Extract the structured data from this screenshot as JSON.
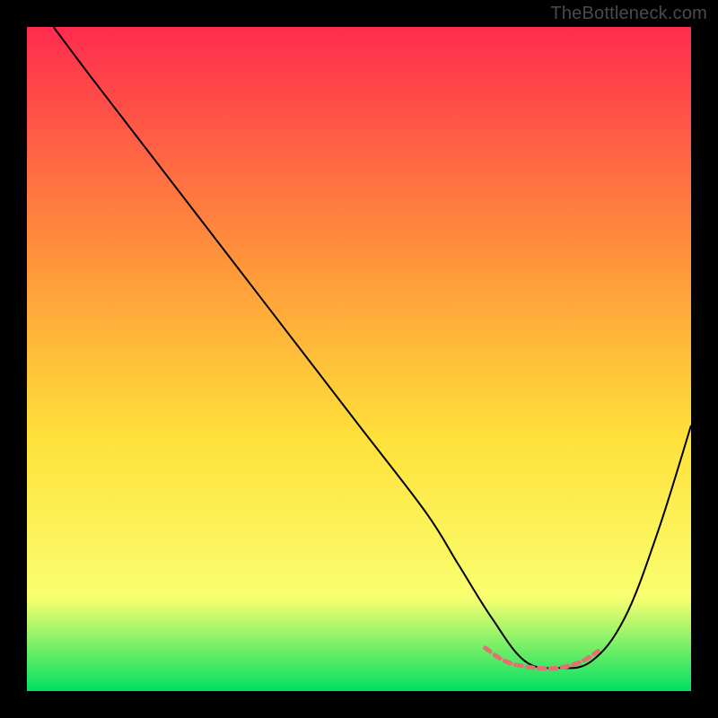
{
  "watermark": "TheBottleneck.com",
  "chart_data": {
    "type": "line",
    "title": "",
    "xlabel": "",
    "ylabel": "",
    "xlim": [
      0,
      100
    ],
    "ylim": [
      0,
      100
    ],
    "grid": false,
    "legend": false,
    "background_gradient": {
      "top": "#ff2b4e",
      "mid1": "#ff9a3a",
      "mid2": "#ffe13a",
      "mid3": "#f9ff70",
      "bottom": "#00e060"
    },
    "series": [
      {
        "name": "curve",
        "color": "#000000",
        "stroke_width": 2,
        "x": [
          4,
          10,
          20,
          30,
          40,
          50,
          60,
          65,
          70,
          75,
          80,
          85,
          90,
          95,
          100
        ],
        "y": [
          100,
          92,
          79,
          66,
          53,
          40,
          27,
          19,
          11,
          4.5,
          3.5,
          4.5,
          11,
          24,
          40
        ]
      },
      {
        "name": "highlight",
        "color": "#e17272",
        "stroke_width": 5,
        "stroke_dasharray": "7,6",
        "x": [
          69,
          72,
          75,
          78,
          80,
          82,
          84,
          86
        ],
        "y": [
          6.5,
          4.5,
          3.7,
          3.4,
          3.5,
          3.9,
          4.7,
          6.0
        ]
      }
    ]
  }
}
